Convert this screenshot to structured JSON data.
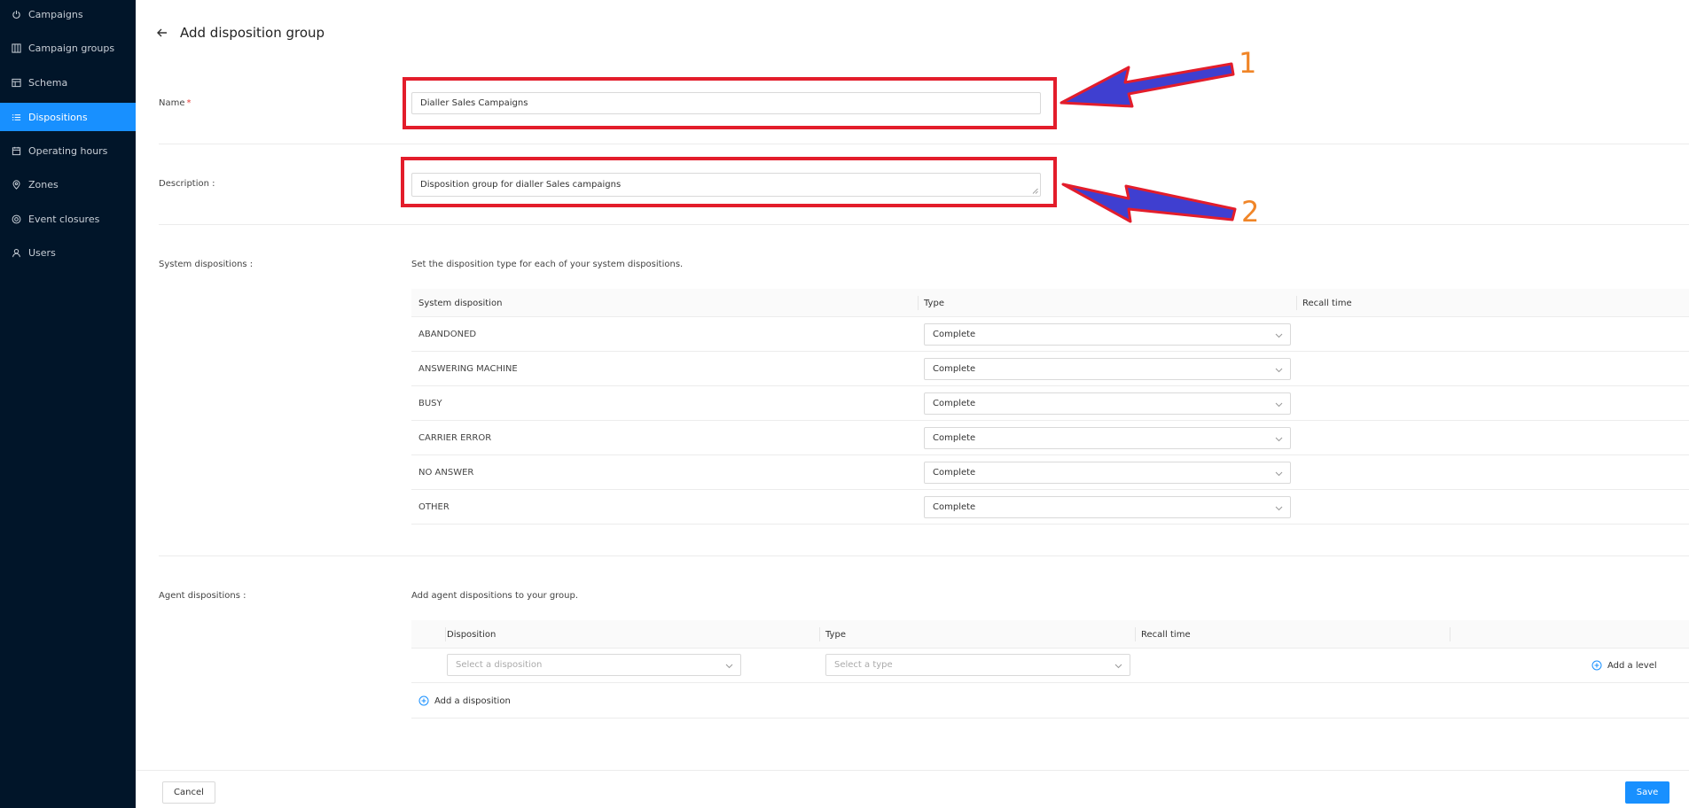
{
  "sidebar": {
    "items": [
      {
        "label": "Campaigns",
        "icon": "power-icon"
      },
      {
        "label": "Campaign groups",
        "icon": "grid-icon"
      },
      {
        "label": "Schema",
        "icon": "table-icon"
      },
      {
        "label": "Dispositions",
        "icon": "list-icon",
        "active": true
      },
      {
        "label": "Operating hours",
        "icon": "calendar-icon"
      },
      {
        "label": "Zones",
        "icon": "location-icon"
      },
      {
        "label": "Event closures",
        "icon": "target-icon"
      },
      {
        "label": "Users",
        "icon": "user-icon"
      }
    ]
  },
  "header": {
    "title": "Add disposition group"
  },
  "form": {
    "name_label": "Name",
    "name_required": "*",
    "name_value": "Dialler Sales Campaigns",
    "description_label": "Description :",
    "description_value": "Disposition group for dialler Sales campaigns"
  },
  "annotations": {
    "one": "1",
    "two": "2"
  },
  "system_dispositions": {
    "label": "System dispositions :",
    "hint": "Set the disposition type for each of your system dispositions.",
    "headers": [
      "System disposition",
      "Type",
      "Recall time"
    ],
    "rows": [
      {
        "name": "ABANDONED",
        "type": "Complete"
      },
      {
        "name": "ANSWERING MACHINE",
        "type": "Complete"
      },
      {
        "name": "BUSY",
        "type": "Complete"
      },
      {
        "name": "CARRIER ERROR",
        "type": "Complete"
      },
      {
        "name": "NO ANSWER",
        "type": "Complete"
      },
      {
        "name": "OTHER",
        "type": "Complete"
      }
    ]
  },
  "agent_dispositions": {
    "label": "Agent dispositions :",
    "hint": "Add agent dispositions to your group.",
    "headers": [
      "Disposition",
      "Type",
      "Recall time"
    ],
    "disposition_placeholder": "Select a disposition",
    "type_placeholder": "Select a type",
    "add_level": "Add a level",
    "add_disposition": "Add a disposition"
  },
  "footer": {
    "cancel": "Cancel",
    "save": "Save"
  },
  "colors": {
    "sidebar_bg": "#011529",
    "accent": "#1890ff",
    "annotation_red": "#e31d2b",
    "annotation_arrow": "#3f3fd0",
    "annotation_number": "#f08527"
  }
}
